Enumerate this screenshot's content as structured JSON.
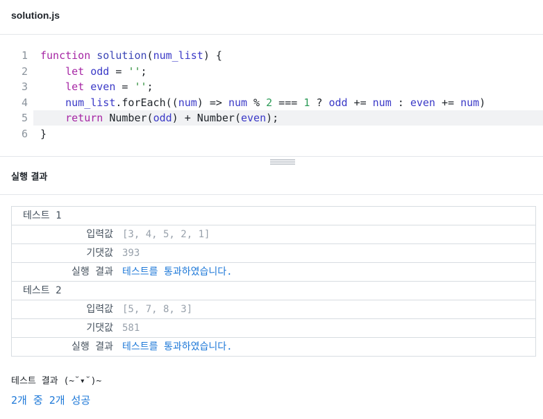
{
  "file": {
    "title": "solution.js"
  },
  "editor": {
    "active_line": 5,
    "lines": [
      {
        "number": "1",
        "tokens": [
          {
            "t": "function",
            "c": "kw"
          },
          {
            "t": " ",
            "c": "plain"
          },
          {
            "t": "solution",
            "c": "fn"
          },
          {
            "t": "(",
            "c": "plain"
          },
          {
            "t": "num_list",
            "c": "id"
          },
          {
            "t": ") {",
            "c": "plain"
          }
        ]
      },
      {
        "number": "2",
        "tokens": [
          {
            "t": "    ",
            "c": "plain"
          },
          {
            "t": "let",
            "c": "kw"
          },
          {
            "t": " ",
            "c": "plain"
          },
          {
            "t": "odd",
            "c": "id"
          },
          {
            "t": " = ",
            "c": "plain"
          },
          {
            "t": "''",
            "c": "str"
          },
          {
            "t": ";",
            "c": "plain"
          }
        ]
      },
      {
        "number": "3",
        "tokens": [
          {
            "t": "    ",
            "c": "plain"
          },
          {
            "t": "let",
            "c": "kw"
          },
          {
            "t": " ",
            "c": "plain"
          },
          {
            "t": "even",
            "c": "id"
          },
          {
            "t": " = ",
            "c": "plain"
          },
          {
            "t": "''",
            "c": "str"
          },
          {
            "t": ";",
            "c": "plain"
          }
        ]
      },
      {
        "number": "4",
        "tokens": [
          {
            "t": "    ",
            "c": "plain"
          },
          {
            "t": "num_list",
            "c": "id"
          },
          {
            "t": ".forEach((",
            "c": "plain"
          },
          {
            "t": "num",
            "c": "id"
          },
          {
            "t": ") => ",
            "c": "plain"
          },
          {
            "t": "num",
            "c": "id"
          },
          {
            "t": " % ",
            "c": "plain"
          },
          {
            "t": "2",
            "c": "num"
          },
          {
            "t": " === ",
            "c": "plain"
          },
          {
            "t": "1",
            "c": "num"
          },
          {
            "t": " ? ",
            "c": "plain"
          },
          {
            "t": "odd",
            "c": "id"
          },
          {
            "t": " += ",
            "c": "plain"
          },
          {
            "t": "num",
            "c": "id"
          },
          {
            "t": " : ",
            "c": "plain"
          },
          {
            "t": "even",
            "c": "id"
          },
          {
            "t": " += ",
            "c": "plain"
          },
          {
            "t": "num",
            "c": "id"
          },
          {
            "t": ")",
            "c": "plain"
          }
        ]
      },
      {
        "number": "5",
        "tokens": [
          {
            "t": "    ",
            "c": "plain"
          },
          {
            "t": "return",
            "c": "kw"
          },
          {
            "t": " Number(",
            "c": "plain"
          },
          {
            "t": "odd",
            "c": "id"
          },
          {
            "t": ") + Number(",
            "c": "plain"
          },
          {
            "t": "even",
            "c": "id"
          },
          {
            "t": ");",
            "c": "plain"
          }
        ]
      },
      {
        "number": "6",
        "tokens": [
          {
            "t": "}",
            "c": "plain"
          }
        ]
      }
    ]
  },
  "results": {
    "title": "실행 결과",
    "row_arrow": "〉",
    "tests": [
      {
        "name": "테스트 1",
        "rows": [
          {
            "label": "입력값",
            "value": "[3, 4, 5, 2, 1]",
            "pass": false
          },
          {
            "label": "기댓값",
            "value": "393",
            "pass": false
          },
          {
            "label": "실행 결과",
            "value": "테스트를 통과하였습니다.",
            "pass": true
          }
        ]
      },
      {
        "name": "테스트 2",
        "rows": [
          {
            "label": "입력값",
            "value": "[5, 7, 8, 3]",
            "pass": false
          },
          {
            "label": "기댓값",
            "value": "581",
            "pass": false
          },
          {
            "label": "실행 결과",
            "value": "테스트를 통과하였습니다.",
            "pass": true
          }
        ]
      }
    ],
    "summary_label": "테스트 결과 (~˘▾˘)~",
    "summary_value": "2개 중 2개 성공"
  }
}
